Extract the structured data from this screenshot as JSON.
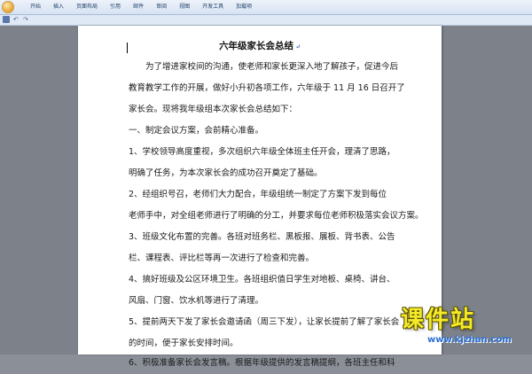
{
  "ribbon": {
    "tabs": [
      "开始",
      "插入",
      "页面布局",
      "引用",
      "邮件",
      "审阅",
      "视图",
      "开发工具",
      "加载项"
    ]
  },
  "quick_access": {
    "undo": "↶",
    "redo": "↷"
  },
  "document": {
    "title": "六年级家长会总结",
    "paragraphs": [
      "　　为了增进家校间的沟通，使老师和家长更深入地了解孩子，促进今后",
      "教育教学工作的开展，做好小升初各项工作，六年级于 11 月 16 日召开了",
      "家长会。现将我年级组本次家长会总结如下：",
      "一、制定会议方案，会前精心准备。",
      "1、学校领导高度重视，多次组织六年级全体班主任开会，理清了思路，",
      "明确了任务，为本次家长会的成功召开奠定了基础。",
      "2、经组织号召，老师们大力配合，年级组统一制定了方案下发到每位",
      "老师手中，对全组老师进行了明确的分工，并要求每位老师积极落实会议方案。",
      "3、班级文化布置的完善。各班对班务栏、黑板报、展板、背书表、公告",
      "栏、课程表、评比栏等再一次进行了检查和完善。",
      "4、搞好班级及公区环境卫生。各班组织值日学生对地板、桌椅、讲台、",
      "风扇、门窗、饮水机等进行了清理。",
      "5、提前两天下发了家长会邀请函（周三下发），让家长提前了解了家长会",
      "的时间，便于家长安排时间。",
      "6、积极准备家长会发言稿。根据年级提供的发言稿提纲，各班主任和科"
    ]
  },
  "watermark": {
    "name": "课件站",
    "url": "www.kjzhan.com"
  }
}
